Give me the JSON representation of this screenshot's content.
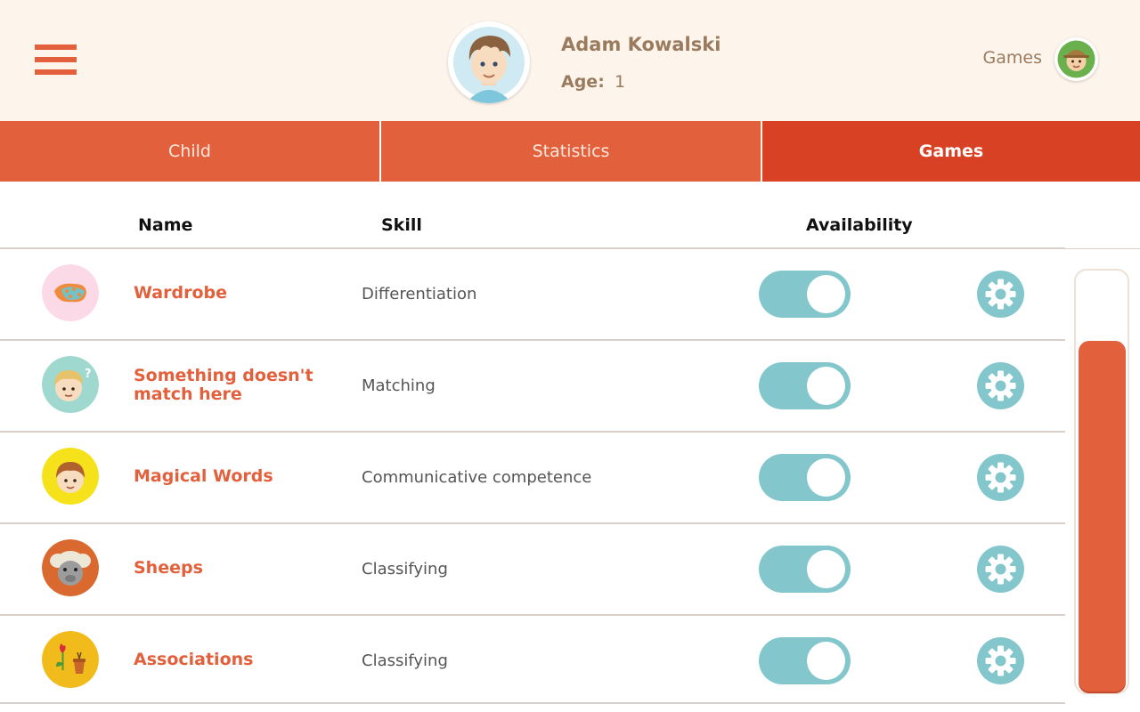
{
  "header": {
    "user_name": "Adam Kowalski",
    "age_label": "Age:",
    "age_value": "1",
    "mode_label": "Games",
    "menu_icon": "hamburger-menu-icon",
    "mode_icon": "child-face-icon"
  },
  "tabs": [
    {
      "label": "Child",
      "active": false
    },
    {
      "label": "Statistics",
      "active": false
    },
    {
      "label": "Games",
      "active": true
    }
  ],
  "columns": {
    "name": "Name",
    "skill": "Skill",
    "availability": "Availability"
  },
  "games": [
    {
      "name": "Wardrobe",
      "skill": "Differentiation",
      "icon": "patterned-cloth-icon",
      "available": true
    },
    {
      "name": "Something doesn't match here",
      "skill": "Matching",
      "icon": "puzzled-boy-icon",
      "available": true
    },
    {
      "name": "Magical Words",
      "skill": "Communicative competence",
      "icon": "boy-face-icon",
      "available": true
    },
    {
      "name": "Sheeps",
      "skill": "Classifying",
      "icon": "sheep-icon",
      "available": true
    },
    {
      "name": "Associations",
      "skill": "Classifying",
      "icon": "flower-and-pot-icon",
      "available": true
    }
  ],
  "colors": {
    "accent": "#e2603c",
    "active_tab": "#d94125",
    "header_bg": "#fdf5ec",
    "toggle": "#83c7cd",
    "brown_text": "#9b7b5e"
  }
}
